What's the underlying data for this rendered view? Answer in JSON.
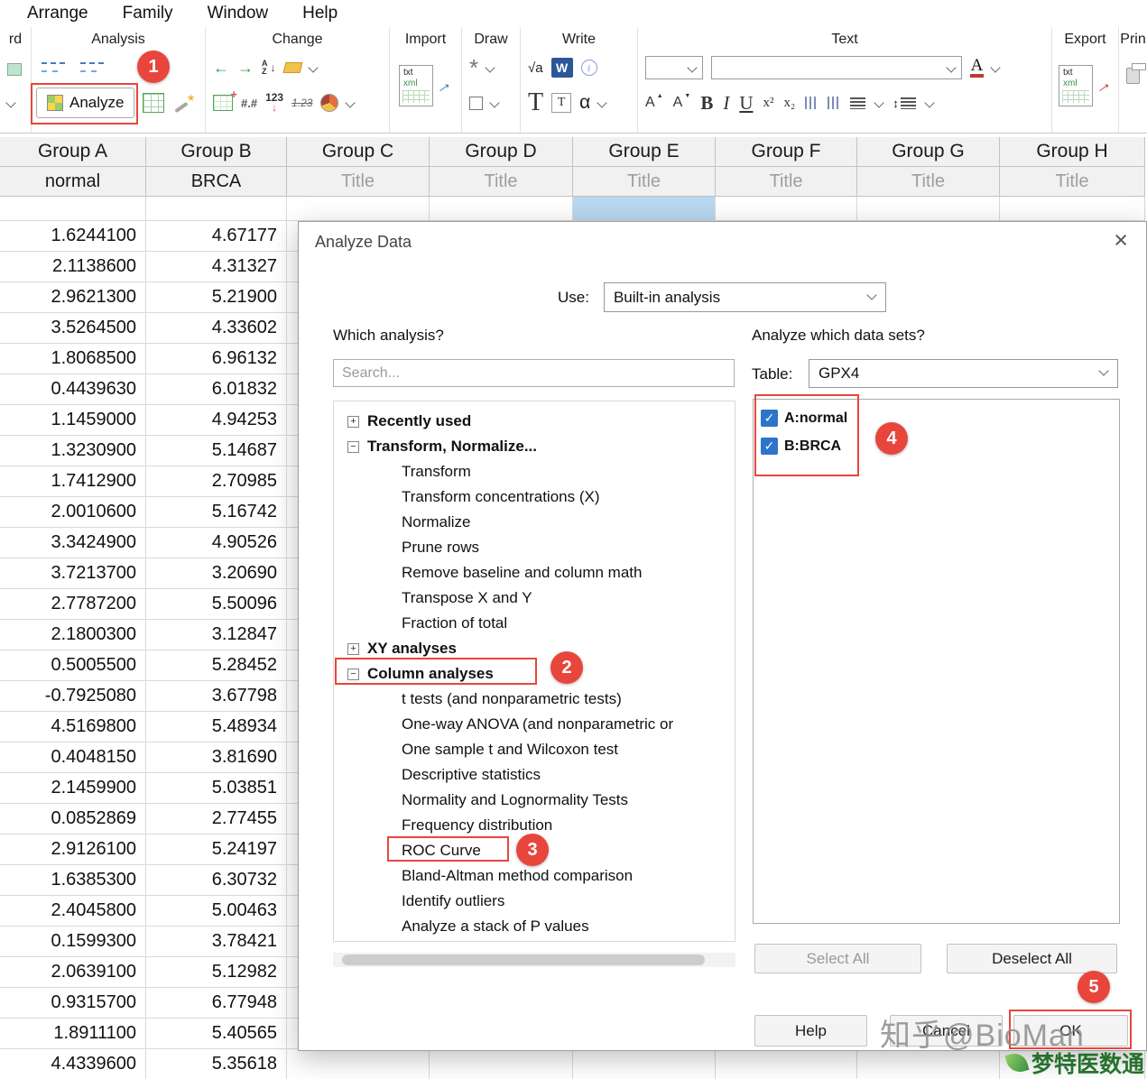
{
  "menubar": {
    "items": [
      "Arrange",
      "Family",
      "Window",
      "Help"
    ]
  },
  "toolbar": {
    "sections": [
      {
        "label": "rd"
      },
      {
        "label": "Analysis"
      },
      {
        "label": "Change"
      },
      {
        "label": "Import"
      },
      {
        "label": "Draw"
      },
      {
        "label": "Write"
      },
      {
        "label": "Text"
      },
      {
        "label": "Export"
      },
      {
        "label": "Prin"
      }
    ],
    "analyze_label": "Analyze",
    "glyphs": {
      "hash": "#.#",
      "one23": "123",
      "strike123": "1.23",
      "sqrt": "√a",
      "word": "W",
      "info": "i",
      "t_big": "T",
      "t_box": "T",
      "alpha": "α",
      "star": "*",
      "a_color": "A",
      "a_up": "A",
      "a_down": "A",
      "bold": "B",
      "italic": "I",
      "underline": "U",
      "sup": "x²",
      "sub": "x₂",
      "txt": "txt",
      "xml": "xml"
    }
  },
  "table": {
    "columns": [
      {
        "name": "Group A",
        "subtitle": "normal"
      },
      {
        "name": "Group B",
        "subtitle": "BRCA"
      },
      {
        "name": "Group C",
        "subtitle": "Title",
        "placeholder": true
      },
      {
        "name": "Group D",
        "subtitle": "Title",
        "placeholder": true
      },
      {
        "name": "Group E",
        "subtitle": "Title",
        "placeholder": true
      },
      {
        "name": "Group F",
        "subtitle": "Title",
        "placeholder": true
      },
      {
        "name": "Group G",
        "subtitle": "Title",
        "placeholder": true
      },
      {
        "name": "Group H",
        "subtitle": "Title",
        "placeholder": true
      }
    ],
    "rows": [
      [
        "1.6244100",
        "4.67177"
      ],
      [
        "2.1138600",
        "4.31327"
      ],
      [
        "2.9621300",
        "5.21900"
      ],
      [
        "3.5264500",
        "4.33602"
      ],
      [
        "1.8068500",
        "6.96132"
      ],
      [
        "0.4439630",
        "6.01832"
      ],
      [
        "1.1459000",
        "4.94253"
      ],
      [
        "1.3230900",
        "5.14687"
      ],
      [
        "1.7412900",
        "2.70985"
      ],
      [
        "2.0010600",
        "5.16742"
      ],
      [
        "3.3424900",
        "4.90526"
      ],
      [
        "3.7213700",
        "3.20690"
      ],
      [
        "2.7787200",
        "5.50096"
      ],
      [
        "2.1800300",
        "3.12847"
      ],
      [
        "0.5005500",
        "5.28452"
      ],
      [
        "-0.7925080",
        "3.67798"
      ],
      [
        "4.5169800",
        "5.48934"
      ],
      [
        "0.4048150",
        "3.81690"
      ],
      [
        "2.1459900",
        "5.03851"
      ],
      [
        "0.0852869",
        "2.77455"
      ],
      [
        "2.9126100",
        "5.24197"
      ],
      [
        "1.6385300",
        "6.30732"
      ],
      [
        "2.4045800",
        "5.00463"
      ],
      [
        "0.1599300",
        "3.78421"
      ],
      [
        "2.0639100",
        "5.12982"
      ],
      [
        "0.9315700",
        "6.77948"
      ],
      [
        "1.8911100",
        "5.40565"
      ],
      [
        "4.4339600",
        "5.35618"
      ]
    ]
  },
  "dialog": {
    "title": "Analyze Data",
    "use_label": "Use:",
    "use_value": "Built-in analysis",
    "which_label": "Which analysis?",
    "search_placeholder": "Search...",
    "datasets_label": "Analyze which data sets?",
    "table_label": "Table:",
    "table_value": "GPX4",
    "tree": [
      {
        "t": "group",
        "state": "plus",
        "label": "Recently used"
      },
      {
        "t": "group",
        "state": "minus",
        "label": "Transform, Normalize..."
      },
      {
        "t": "item",
        "label": "Transform"
      },
      {
        "t": "item",
        "label": "Transform concentrations (X)"
      },
      {
        "t": "item",
        "label": "Normalize"
      },
      {
        "t": "item",
        "label": "Prune rows"
      },
      {
        "t": "item",
        "label": "Remove baseline and column math"
      },
      {
        "t": "item",
        "label": "Transpose X and Y"
      },
      {
        "t": "item",
        "label": "Fraction of total"
      },
      {
        "t": "group",
        "state": "plus",
        "label": "XY analyses"
      },
      {
        "t": "group",
        "state": "minus",
        "label": "Column analyses"
      },
      {
        "t": "item",
        "label": "t tests (and nonparametric tests)"
      },
      {
        "t": "item",
        "label": "One-way ANOVA (and nonparametric or"
      },
      {
        "t": "item",
        "label": "One sample t and Wilcoxon test"
      },
      {
        "t": "item",
        "label": "Descriptive statistics"
      },
      {
        "t": "item",
        "label": "Normality and Lognormality Tests"
      },
      {
        "t": "item",
        "label": "Frequency distribution"
      },
      {
        "t": "item",
        "label": "ROC Curve"
      },
      {
        "t": "item",
        "label": "Bland-Altman method comparison"
      },
      {
        "t": "item",
        "label": "Identify outliers"
      },
      {
        "t": "item",
        "label": "Analyze a stack of P values"
      },
      {
        "t": "group",
        "state": "minus",
        "label": ""
      }
    ],
    "datasets": [
      {
        "label": "A:normal",
        "checked": true
      },
      {
        "label": "B:BRCA",
        "checked": true
      }
    ],
    "buttons": {
      "select_all": "Select All",
      "deselect_all": "Deselect All",
      "help": "Help",
      "cancel": "Cancel",
      "ok": "OK"
    }
  },
  "annotations": {
    "steps": [
      "1",
      "2",
      "3",
      "4",
      "5"
    ]
  },
  "watermarks": {
    "zhihu": "知乎@BioMan",
    "brand": "梦特医数通"
  },
  "colors": {
    "annotation": "#e8463c",
    "checkbox": "#2e74c9",
    "selected_cell": "#b8d7f0",
    "accent_green": "#3f9c42"
  }
}
